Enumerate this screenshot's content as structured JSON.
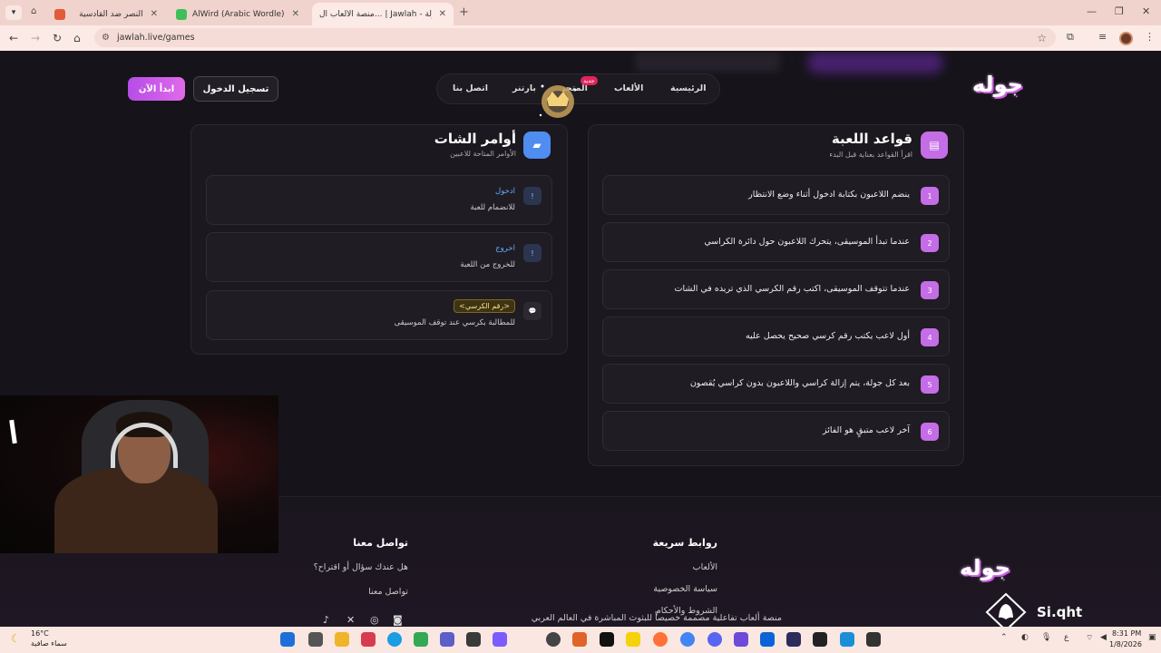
{
  "browser": {
    "tabs": [
      {
        "title": "النصر ضد القادسية",
        "active": false
      },
      {
        "title": "AlWird (Arabic Wordle) - الورد",
        "active": false
      },
      {
        "title": "منصة الألعاب ال... | Jawlah - جولة",
        "active": true
      }
    ],
    "url": "jawlah.live/games"
  },
  "header": {
    "logo": "جوله",
    "start_button": "ابدأ الآن",
    "login_button": "تسجيل الدخول",
    "nav": [
      "الرئيسية",
      "الألعاب",
      "المتجر",
      "بارتنر",
      "اتصل بنا"
    ],
    "new_badge": "جديد"
  },
  "rules_card": {
    "title": "قواعد اللعبة",
    "subtitle": "اقرأ القواعد بعناية قبل البدء",
    "rules": [
      {
        "num": "1",
        "text": "ينضم اللاعبون بكتابة ادخول أثناء وضع الانتظار"
      },
      {
        "num": "2",
        "text": "عندما تبدأ الموسيقى، يتحرك اللاعبون حول دائرة الكراسي"
      },
      {
        "num": "3",
        "text": "عندما تتوقف الموسيقى، اكتب رقم الكرسي الذي تريده في الشات"
      },
      {
        "num": "4",
        "text": "أول لاعب يكتب رقم كرسي صحيح يحصل عليه"
      },
      {
        "num": "5",
        "text": "بعد كل جولة، يتم إزالة كراسي واللاعبون بدون كراسي يُقصون"
      },
      {
        "num": "6",
        "text": "آخر لاعب متبقٍ هو الفائز"
      }
    ]
  },
  "commands_card": {
    "title": "أوامر الشات",
    "subtitle": "الأوامر المتاحة للاعبين",
    "commands": [
      {
        "badge": "!",
        "name": "ادخول",
        "desc": "للانضمام للعبة"
      },
      {
        "badge": "!",
        "name": "اخروج",
        "desc": "للخروج من اللعبة"
      },
      {
        "badge": "💬",
        "name": "<رقم الكرسي>",
        "desc": "للمطالبة بكرسي عند توقف الموسيقى"
      }
    ]
  },
  "footer": {
    "logo": "جوله",
    "description": "منصة ألعاب تفاعلية مصممة خصيصاً للبثوث المباشرة في العالم العربي",
    "quick_links_title": "روابط سريعة",
    "quick_links": [
      "الألعاب",
      "سياسة الخصوصية",
      "الشروط والأحكام"
    ],
    "contact_title": "تواصل معنا",
    "contact_links": [
      "هل عندك سؤال أو اقتراح؟",
      "تواصل معنا"
    ]
  },
  "watermark": "Si.qht",
  "taskbar": {
    "weather_temp": "16°C",
    "weather_desc": "سماء صافية",
    "time": "8:31 PM",
    "date": "1/8/2026",
    "lang": "ع"
  },
  "colors": {
    "accent": "#c46de6",
    "command_accent": "#6aa9ff",
    "background": "#16131a"
  }
}
